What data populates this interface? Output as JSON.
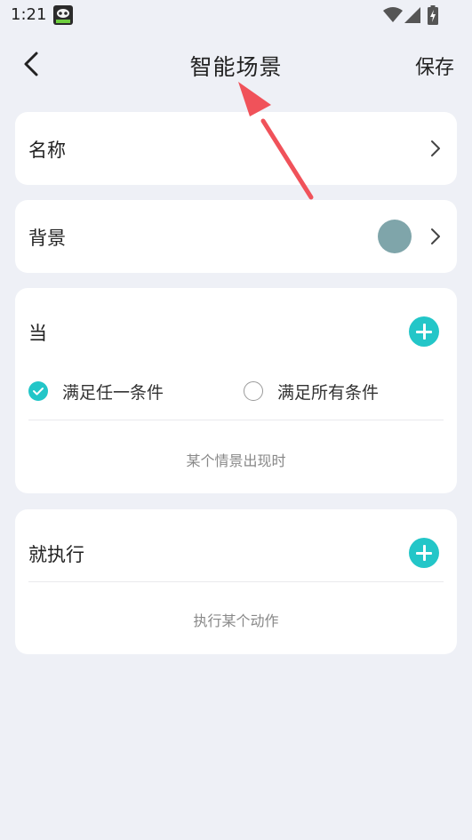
{
  "status_bar": {
    "time": "1:21",
    "icons": [
      "app-notification-icon",
      "wifi-icon",
      "signal-icon",
      "battery-icon"
    ]
  },
  "header": {
    "title": "智能场景",
    "save_label": "保存",
    "back_icon": "back-arrow-icon"
  },
  "name_row": {
    "label": "名称"
  },
  "background_row": {
    "label": "背景",
    "swatch_color": "#7fa5aa"
  },
  "when_section": {
    "label": "当",
    "options": [
      {
        "label": "满足任一条件",
        "checked": true
      },
      {
        "label": "满足所有条件",
        "checked": false
      }
    ],
    "hint": "某个情景出现时"
  },
  "then_section": {
    "label": "就执行",
    "hint": "执行某个动作"
  },
  "colors": {
    "accent": "#23c6c8",
    "background": "#eef0f6",
    "annotation": "#f0525a"
  }
}
